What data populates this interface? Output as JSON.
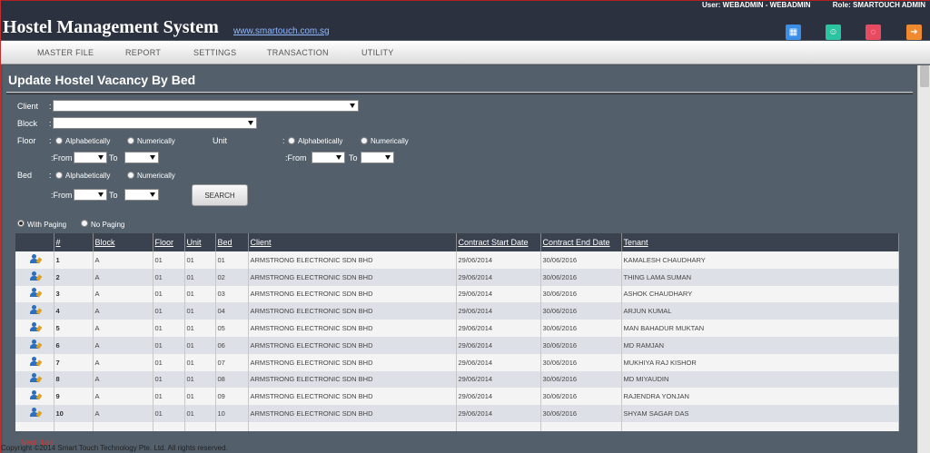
{
  "header": {
    "user": "User: WEBADMIN - WEBADMIN",
    "role": "Role: SMARTOUCH ADMIN",
    "title": "Hostel Management System",
    "link": "www.smartouch.com.sg",
    "icons": [
      {
        "name": "calendar-icon",
        "glyph": "▦",
        "color": "#3a8ee6"
      },
      {
        "name": "user-icon",
        "glyph": "☺",
        "color": "#2bc4a0"
      },
      {
        "name": "chat-icon",
        "glyph": "◌",
        "color": "#e84a5f"
      },
      {
        "name": "logout-icon",
        "glyph": "➜",
        "color": "#f08a30"
      }
    ]
  },
  "menu": [
    "MASTER FILE",
    "REPORT",
    "SETTINGS",
    "TRANSACTION",
    "UTILITY"
  ],
  "page": {
    "title": "Update Hostel Vacancy By Bed"
  },
  "filters": {
    "client_label": "Client",
    "block_label": "Block",
    "floor_label": "Floor",
    "unit_label": "Unit",
    "bed_label": "Bed",
    "colon": ":",
    "alphabetically": "Alphabetically",
    "numerically": "Numerically",
    "from": ":From",
    "to": "To",
    "search": "SEARCH",
    "with_paging": "With Paging",
    "no_paging": "No Paging"
  },
  "table": {
    "columns": [
      "#",
      "Block",
      "Floor",
      "Unit",
      "Bed",
      "Client",
      "Contract Start Date",
      "Contract End Date",
      "Tenant"
    ],
    "rows": [
      {
        "n": "1",
        "block": "A",
        "floor": "01",
        "unit": "01",
        "bed": "01",
        "client": "ARMSTRONG ELECTRONIC SDN BHD",
        "start": "29/06/2014",
        "end": "30/06/2016",
        "tenant": "KAMALESH CHAUDHARY"
      },
      {
        "n": "2",
        "block": "A",
        "floor": "01",
        "unit": "01",
        "bed": "02",
        "client": "ARMSTRONG ELECTRONIC SDN BHD",
        "start": "29/06/2014",
        "end": "30/06/2016",
        "tenant": "THING LAMA SUMAN"
      },
      {
        "n": "3",
        "block": "A",
        "floor": "01",
        "unit": "01",
        "bed": "03",
        "client": "ARMSTRONG ELECTRONIC SDN BHD",
        "start": "29/06/2014",
        "end": "30/06/2016",
        "tenant": "ASHOK CHAUDHARY"
      },
      {
        "n": "4",
        "block": "A",
        "floor": "01",
        "unit": "01",
        "bed": "04",
        "client": "ARMSTRONG ELECTRONIC SDN BHD",
        "start": "29/06/2014",
        "end": "30/06/2016",
        "tenant": "ARJUN KUMAL"
      },
      {
        "n": "5",
        "block": "A",
        "floor": "01",
        "unit": "01",
        "bed": "05",
        "client": "ARMSTRONG ELECTRONIC SDN BHD",
        "start": "29/06/2014",
        "end": "30/06/2016",
        "tenant": "MAN BAHADUR MUKTAN"
      },
      {
        "n": "6",
        "block": "A",
        "floor": "01",
        "unit": "01",
        "bed": "06",
        "client": "ARMSTRONG ELECTRONIC SDN BHD",
        "start": "29/06/2014",
        "end": "30/06/2016",
        "tenant": "MD RAMJAN"
      },
      {
        "n": "7",
        "block": "A",
        "floor": "01",
        "unit": "01",
        "bed": "07",
        "client": "ARMSTRONG ELECTRONIC SDN BHD",
        "start": "29/06/2014",
        "end": "30/06/2016",
        "tenant": "MUKHIYA RAJ KISHOR"
      },
      {
        "n": "8",
        "block": "A",
        "floor": "01",
        "unit": "01",
        "bed": "08",
        "client": "ARMSTRONG ELECTRONIC SDN BHD",
        "start": "29/06/2014",
        "end": "30/06/2016",
        "tenant": "MD MIYAUDIN"
      },
      {
        "n": "9",
        "block": "A",
        "floor": "01",
        "unit": "01",
        "bed": "09",
        "client": "ARMSTRONG ELECTRONIC SDN BHD",
        "start": "29/06/2014",
        "end": "30/06/2016",
        "tenant": "RAJENDRA YONJAN"
      },
      {
        "n": "10",
        "block": "A",
        "floor": "01",
        "unit": "01",
        "bed": "10",
        "client": "ARMSTRONG ELECTRONIC SDN BHD",
        "start": "29/06/2014",
        "end": "30/06/2016",
        "tenant": "SHYAM SAGAR DAS"
      }
    ]
  },
  "pager": {
    "next": "Next",
    "last": "Last"
  },
  "footer": {
    "copyright": "Copyright ©2014 Smart Touch Technology Pte. Ltd. All rights reserved."
  }
}
